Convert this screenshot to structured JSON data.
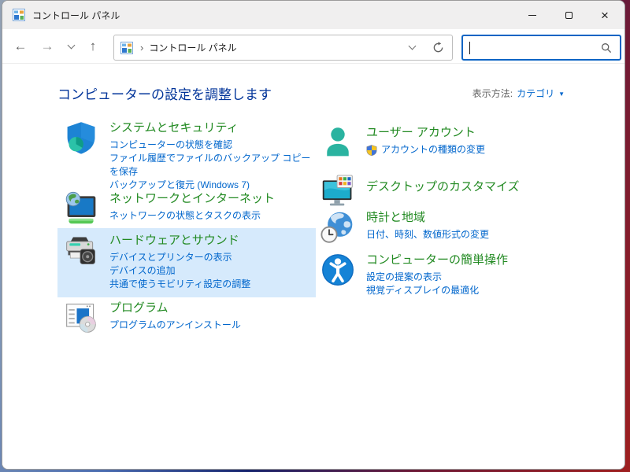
{
  "window": {
    "title": "コントロール パネル"
  },
  "toolbar": {
    "breadcrumb": {
      "chevron": "›",
      "location": "コントロール パネル"
    },
    "search": {
      "value": "",
      "placeholder": ""
    }
  },
  "header": {
    "title": "コンピューターの設定を調整します",
    "view_by_label": "表示方法:",
    "view_by_value": "カテゴリ",
    "view_by_arrow": "▼"
  },
  "categories": {
    "left": [
      {
        "title": "システムとセキュリティ",
        "icon": "shield-security-icon",
        "links": [
          "コンピューターの状態を確認",
          "ファイル履歴でファイルのバックアップ コピーを保存",
          "バックアップと復元 (Windows 7)"
        ]
      },
      {
        "title": "ネットワークとインターネット",
        "icon": "network-monitor-globe-icon",
        "links": [
          "ネットワークの状態とタスクの表示"
        ]
      },
      {
        "title": "ハードウェアとサウンド",
        "icon": "printer-speaker-icon",
        "highlighted": true,
        "links": [
          "デバイスとプリンターの表示",
          "デバイスの追加",
          "共通で使うモビリティ設定の調整"
        ]
      },
      {
        "title": "プログラム",
        "icon": "program-window-disc-icon",
        "links": [
          "プログラムのアンインストール"
        ]
      }
    ],
    "right": [
      {
        "title": "ユーザー アカウント",
        "icon": "user-silhouette-icon",
        "links": [
          "アカウントの種類の変更"
        ],
        "link_has_uac_shield": true
      },
      {
        "title": "デスクトップのカスタマイズ",
        "icon": "monitor-palette-icon",
        "links": []
      },
      {
        "title": "時計と地域",
        "icon": "globe-clock-icon",
        "links": [
          "日付、時刻、数値形式の変更"
        ]
      },
      {
        "title": "コンピューターの簡単操作",
        "icon": "accessibility-icon",
        "links": [
          "設定の提案の表示",
          "視覚ディスプレイの最適化"
        ]
      }
    ]
  },
  "icons": {
    "back-icon": "←",
    "forward-icon": "→",
    "up-icon": "↑",
    "history-chevron-icon": "chevron-down",
    "address-dropdown-icon": "chevron-down",
    "refresh-icon": "circular-arrow",
    "search-icon": "magnifier",
    "uac-shield-icon": "blue-yellow-shield",
    "minimize-icon": "line",
    "maximize-icon": "square",
    "close-icon": "×"
  },
  "colors": {
    "category_title_green": "#228a22",
    "task_link_blue": "#0066cc",
    "page_title_navy": "#003399",
    "hover_highlight": "#d6eafc",
    "search_focus_border": "#0b64c4"
  }
}
